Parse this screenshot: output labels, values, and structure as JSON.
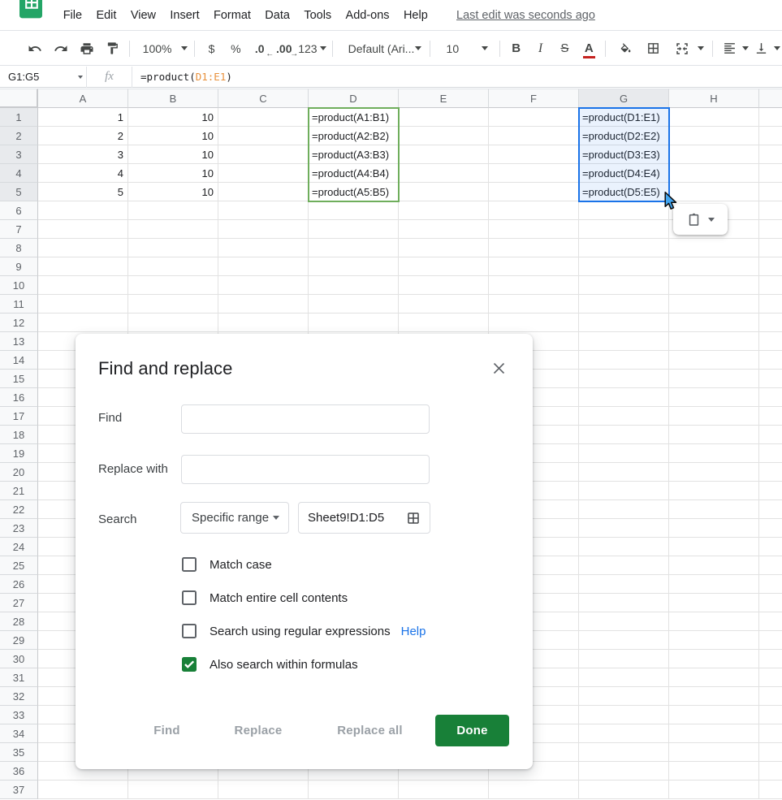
{
  "menubar": {
    "items": [
      {
        "name": "file",
        "label": "File"
      },
      {
        "name": "edit",
        "label": "Edit"
      },
      {
        "name": "view",
        "label": "View"
      },
      {
        "name": "insert",
        "label": "Insert"
      },
      {
        "name": "format",
        "label": "Format"
      },
      {
        "name": "data",
        "label": "Data"
      },
      {
        "name": "tools",
        "label": "Tools"
      },
      {
        "name": "add-ons",
        "label": "Add-ons"
      },
      {
        "name": "help",
        "label": "Help"
      }
    ],
    "last_edit": "Last edit was seconds ago"
  },
  "toolbar": {
    "zoom": "100%",
    "currency": "$",
    "percent": "%",
    "decrease_decimal": ".0",
    "increase_decimal": ".00",
    "more_formats": "123",
    "font_name": "Default (Ari...",
    "font_size": "10",
    "bold": "B",
    "italic": "I",
    "strikethrough": "S",
    "text_color": "A"
  },
  "formula_bar": {
    "name_box": "G1:G5",
    "fx": "fx",
    "formula_prefix": "=product(",
    "formula_range": "D1:E1",
    "formula_suffix": ")",
    "range_color": "#e8913c"
  },
  "grid": {
    "columns": [
      "A",
      "B",
      "C",
      "D",
      "E",
      "F",
      "G",
      "H"
    ],
    "row_count": 37,
    "cells": {
      "A1": "1",
      "A2": "2",
      "A3": "3",
      "A4": "4",
      "A5": "5",
      "B1": "10",
      "B2": "10",
      "B3": "10",
      "B4": "10",
      "B5": "10",
      "D1": "=product(A1:B1)",
      "D2": "=product(A2:B2)",
      "D3": "=product(A3:B3)",
      "D4": "=product(A4:B4)",
      "D5": "=product(A5:B5)",
      "G1": "=product(D1:E1)",
      "G2": "=product(D2:E2)",
      "G3": "=product(D3:E3)",
      "G4": "=product(D4:E4)",
      "G5": "=product(D5:E5)"
    },
    "selection": {
      "range": "G1:G5",
      "border_color": "#1a73e8",
      "fill": "rgba(26,115,232,0.09)"
    },
    "highlight_range": {
      "range": "D1:D5",
      "border_color": "#6fae5c"
    }
  },
  "dialog": {
    "title": "Find and replace",
    "find_label": "Find",
    "find_value": "",
    "replace_label": "Replace with",
    "replace_value": "",
    "search_label": "Search",
    "search_value": "Specific range",
    "range_value": "Sheet9!D1:D5",
    "checkboxes": [
      {
        "label": "Match case",
        "checked": false
      },
      {
        "label": "Match entire cell contents",
        "checked": false
      },
      {
        "label": "Search using regular expressions",
        "checked": false,
        "link": "Help"
      },
      {
        "label": "Also search within formulas",
        "checked": true
      }
    ],
    "buttons": {
      "find": "Find",
      "replace": "Replace",
      "replace_all": "Replace all",
      "done": "Done"
    },
    "accent_green": "#188038",
    "link_blue": "#1a73e8"
  }
}
